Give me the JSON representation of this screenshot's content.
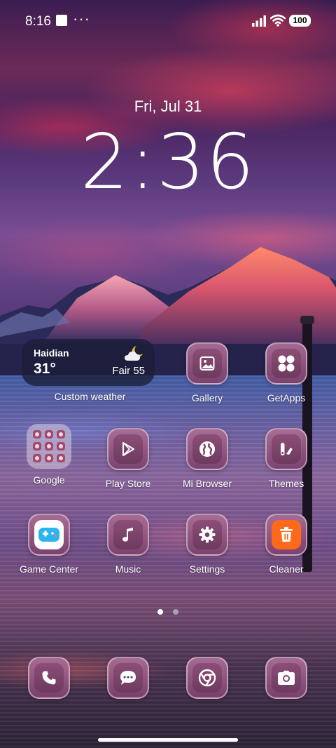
{
  "status_bar": {
    "time": "8:16",
    "overflow": "···",
    "battery": "100",
    "icons": [
      "notification-square-icon",
      "signal-icon",
      "wifi-icon",
      "battery-icon"
    ]
  },
  "lock": {
    "date": "Fri, Jul 31",
    "time": "2:36"
  },
  "weather": {
    "city": "Haidian",
    "temp": "31°",
    "condition": "Fair 55",
    "label": "Custom weather",
    "icon": "partly-cloudy-night-icon"
  },
  "apps": {
    "gallery": "Gallery",
    "getapps": "GetApps",
    "google": "Google",
    "playstore": "Play Store",
    "browser": "Mi Browser",
    "themes": "Themes",
    "gamecenter": "Game Center",
    "music": "Music",
    "settings": "Settings",
    "cleaner": "Cleaner"
  },
  "dock": [
    "phone-icon",
    "messages-icon",
    "chrome-icon",
    "camera-icon"
  ],
  "pages": {
    "count": 2,
    "active": 1
  },
  "colors": {
    "icon_tile": "#8c4e76",
    "weather_bg": "#191e37",
    "cleaner_accent": "#ff6a1a",
    "game_accent": "#2bb4f0"
  }
}
